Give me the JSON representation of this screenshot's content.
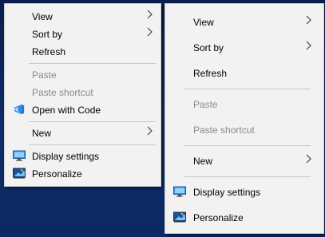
{
  "desktop": {
    "background_color": "#0d2c6a"
  },
  "menu_left": {
    "items": [
      {
        "label": "View",
        "has_submenu": true
      },
      {
        "label": "Sort by",
        "has_submenu": true
      },
      {
        "label": "Refresh"
      },
      {
        "label": "Paste",
        "disabled": true
      },
      {
        "label": "Paste shortcut",
        "disabled": true
      },
      {
        "label": "Open with Code",
        "icon": "vscode-icon"
      },
      {
        "label": "New",
        "has_submenu": true
      },
      {
        "label": "Display settings",
        "icon": "display-settings-icon"
      },
      {
        "label": "Personalize",
        "icon": "personalize-icon"
      }
    ]
  },
  "menu_right": {
    "items": [
      {
        "label": "View",
        "has_submenu": true
      },
      {
        "label": "Sort by",
        "has_submenu": true
      },
      {
        "label": "Refresh"
      },
      {
        "label": "Paste",
        "disabled": true
      },
      {
        "label": "Paste shortcut",
        "disabled": true
      },
      {
        "label": "New",
        "has_submenu": true
      },
      {
        "label": "Display settings",
        "icon": "display-settings-icon"
      },
      {
        "label": "Personalize",
        "icon": "personalize-icon"
      }
    ]
  },
  "colors": {
    "menu_bg": "#f2f2f2",
    "disabled_text": "#8a8a8a",
    "separator": "#c8c8c8",
    "vscode_blue": "#1f7ad2"
  }
}
